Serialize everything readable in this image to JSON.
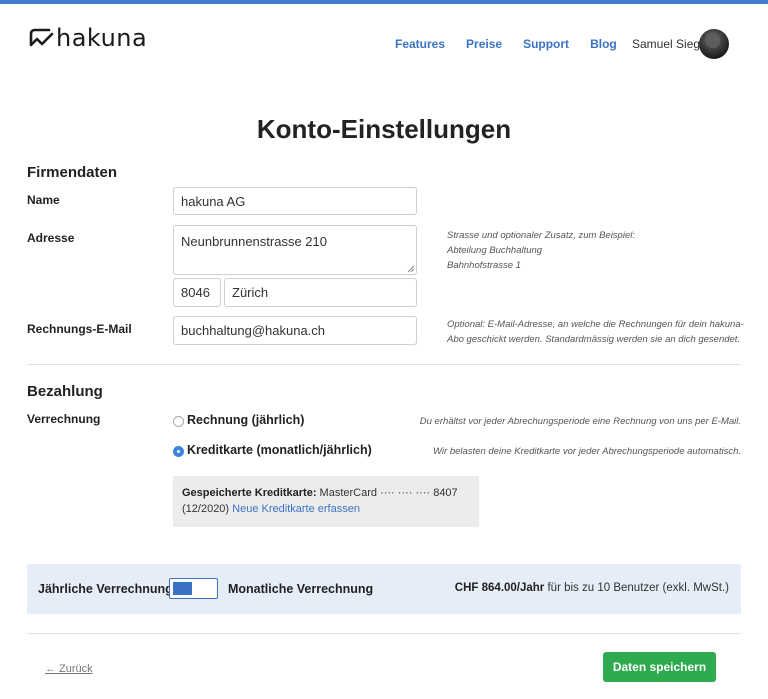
{
  "brand": {
    "name": "hakuna",
    "accent": "#3f7bd0",
    "save_color": "#2eaa4f"
  },
  "nav": {
    "items": [
      {
        "label": "Features"
      },
      {
        "label": "Preise"
      },
      {
        "label": "Support"
      },
      {
        "label": "Blog"
      }
    ]
  },
  "user": {
    "name": "Samuel Sieg",
    "avatar_icon": "avatar"
  },
  "page": {
    "title": "Konto-Einstellungen"
  },
  "company": {
    "section_title": "Firmendaten",
    "name_label": "Name",
    "name_value": "hakuna AG",
    "address_label": "Adresse",
    "address_value": "Neunbrunnenstrasse 210",
    "address_hint": [
      "Strasse und optionaler Zusatz, zum Beispiel:",
      "Abteilung Buchhaltung",
      "Bahnhofstrasse 1"
    ],
    "zip_value": "8046",
    "city_value": "Zürich",
    "email_label": "Rechnungs-E-Mail",
    "email_value": "buchhaltung@hakuna.ch",
    "email_hint": [
      "Optional: E-Mail-Adresse, an welche die Rechnungen für dein hakuna-",
      "Abo geschickt werden. Standardmässig werden sie an dich gesendet."
    ]
  },
  "payment": {
    "section_title": "Bezahlung",
    "billing_label": "Verrechnung",
    "options": [
      {
        "label": "Rechnung (jährlich)",
        "hint": "Du erhältst vor jeder Abrechungsperiode eine Rechnung von uns per E-Mail.",
        "checked": false
      },
      {
        "label": "Kreditkarte (monatlich/jährlich)",
        "hint": "Wir belasten deine Kreditkarte vor jeder Abrechungsperiode automatisch.",
        "checked": true
      }
    ],
    "card": {
      "prefix": "Gespeicherte Kreditkarte:",
      "details": " MasterCard ···· ···· ···· 8407",
      "expiry": "(12/2020)",
      "new_card_link": "Neue Kreditkarte erfassen"
    }
  },
  "billing_bar": {
    "yearly_label": "Jährliche Verrechnung",
    "monthly_label": "Monatliche Verrechnung",
    "toggle_state": "yearly",
    "price": "CHF 864.00/Jahr",
    "price_suffix": " für bis zu 10 Benutzer (exkl. MwSt.)"
  },
  "footer": {
    "back_label": "← Zurück",
    "save_label": "Daten speichern"
  }
}
